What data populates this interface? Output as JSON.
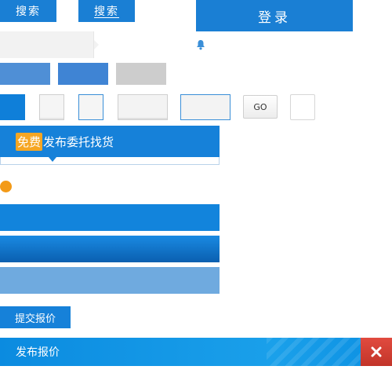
{
  "toolbar": {
    "search_label_1": "搜索",
    "search_label_2": "搜索",
    "login_label": "登录"
  },
  "controls": {
    "go_label": "GO"
  },
  "free_banner": {
    "tag": "免费",
    "text": "发布委托找货"
  },
  "actions": {
    "submit_quote_label": "提交报价"
  },
  "publish_panel": {
    "title": "发布报价"
  },
  "icons": {
    "bell": "bell-icon",
    "close": "close-icon"
  },
  "colors": {
    "primary": "#1681d9",
    "accent_orange": "#f39a17",
    "close_red": "#d43f34"
  }
}
